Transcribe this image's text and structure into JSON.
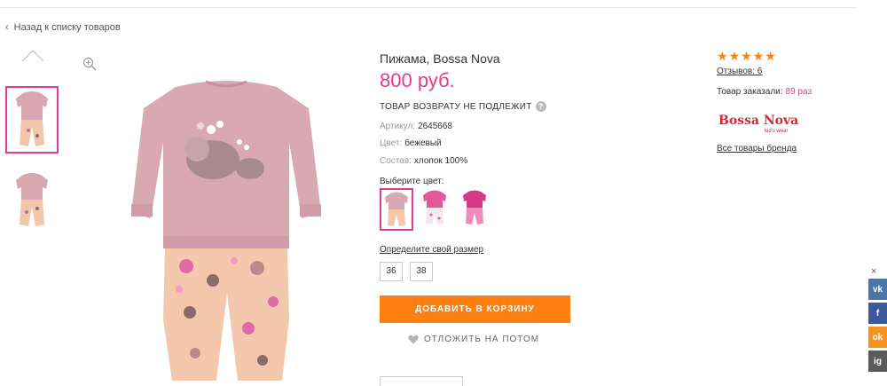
{
  "nav": {
    "back_label": "Назад к списку товаров"
  },
  "product": {
    "title": "Пижама, Bossa Nova",
    "price": "800 руб.",
    "no_return": "ТОВАР ВОЗВРАТУ НЕ ПОДЛЕЖИТ",
    "specs": [
      {
        "label": "Артикул:",
        "value": "2645668"
      },
      {
        "label": "Цвет:",
        "value": "бежевый"
      },
      {
        "label": "Состав:",
        "value": "хлопок 100%"
      }
    ],
    "choose_color_label": "Выберите цвет:",
    "size_link": "Определите свой размер",
    "sizes": [
      "36",
      "38"
    ],
    "add_to_cart": "ДОБАВИТЬ В КОРЗИНУ",
    "save_later": "ОТЛОЖИТЬ НА ПОТОМ"
  },
  "sidebar": {
    "rating": 5,
    "reviews": "Отзывов: 6",
    "ordered_label": "Товар заказали:",
    "ordered_count": "89 раз",
    "brand_name": "Bossa Nova",
    "brand_tagline": "kid's wear",
    "brand_link": "Все товары бренда"
  },
  "share": {
    "close": "×",
    "vk": "vk",
    "fb": "f",
    "ok": "ok",
    "ig": "ig"
  },
  "colors": {
    "accent": "#e63a8c",
    "button": "#ff7f11",
    "star": "#ff7f11"
  }
}
